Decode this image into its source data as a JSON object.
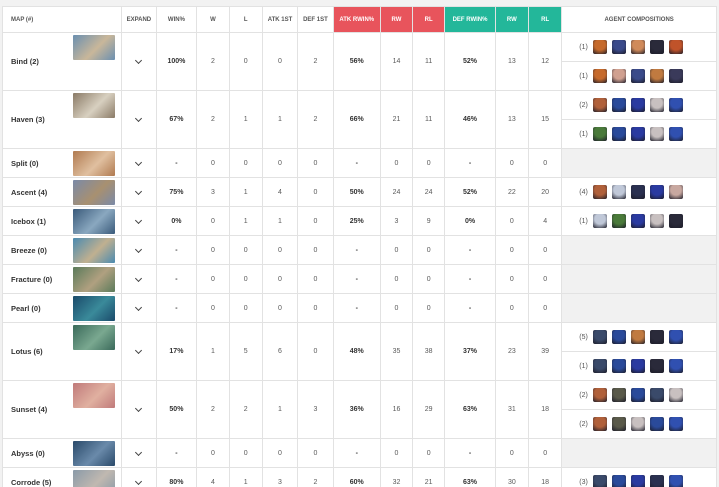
{
  "headers": {
    "map": "MAP (#)",
    "expand": "EXPAND",
    "win": "WIN%",
    "w": "W",
    "l": "L",
    "atk1st": "ATK 1ST",
    "def1st": "DEF 1ST",
    "atk_rwin": "ATK RWIN%",
    "atk_rw": "RW",
    "atk_rl": "RL",
    "def_rwin": "DEF RWIN%",
    "def_rw": "RW",
    "def_rl": "RL",
    "agents": "AGENT COMPOSITIONS"
  },
  "colors": {
    "atk": "#e8545c",
    "def": "#23b79a"
  },
  "rows": [
    {
      "map": "Bind (2)",
      "thumb": [
        "#6a8fb0",
        "#c9b79a"
      ],
      "win": "100%",
      "w": "2",
      "l": "0",
      "atk1st": "0",
      "def1st": "2",
      "atk_rwin": "56%",
      "atk_rw": "14",
      "atk_rl": "11",
      "def_rwin": "52%",
      "def_rw": "13",
      "def_rl": "12",
      "comps": [
        {
          "count": "(1)",
          "agents": [
            "#c66a2c",
            "#3a4a8a",
            "#d08a5a",
            "#2a2a3a",
            "#c0532a"
          ]
        },
        {
          "count": "(1)",
          "agents": [
            "#c66a2c",
            "#d0a090",
            "#3a4a8a",
            "#c07a40",
            "#3a3a5a"
          ]
        }
      ]
    },
    {
      "map": "Haven (3)",
      "thumb": [
        "#8a7a66",
        "#d8d0c0"
      ],
      "win": "67%",
      "w": "2",
      "l": "1",
      "atk1st": "1",
      "def1st": "2",
      "atk_rwin": "66%",
      "atk_rw": "21",
      "atk_rl": "11",
      "def_rwin": "46%",
      "def_rw": "13",
      "def_rl": "15",
      "comps": [
        {
          "count": "(2)",
          "agents": [
            "#b0603a",
            "#2a4a9a",
            "#2a3aa0",
            "#c8c0c0",
            "#3050b0"
          ]
        },
        {
          "count": "(1)",
          "agents": [
            "#4a7a3a",
            "#2a4a9a",
            "#2a3aa0",
            "#c8c0c0",
            "#3050b0"
          ]
        }
      ]
    },
    {
      "map": "Split (0)",
      "thumb": [
        "#b07a50",
        "#e0c0a0"
      ],
      "win": "-",
      "w": "0",
      "l": "0",
      "atk1st": "0",
      "def1st": "0",
      "atk_rwin": "-",
      "atk_rw": "0",
      "atk_rl": "0",
      "def_rwin": "-",
      "def_rw": "0",
      "def_rl": "0",
      "comps": []
    },
    {
      "map": "Ascent (4)",
      "thumb": [
        "#7a8aa8",
        "#a89070"
      ],
      "win": "75%",
      "w": "3",
      "l": "1",
      "atk1st": "4",
      "def1st": "0",
      "atk_rwin": "50%",
      "atk_rw": "24",
      "atk_rl": "24",
      "def_rwin": "52%",
      "def_rw": "22",
      "def_rl": "20",
      "comps": [
        {
          "count": "(4)",
          "agents": [
            "#b0603a",
            "#c0c8d8",
            "#2a3050",
            "#2a3aa0",
            "#c8a8a0"
          ]
        }
      ]
    },
    {
      "map": "Icebox (1)",
      "thumb": [
        "#3a5a7a",
        "#8aa8c0"
      ],
      "win": "0%",
      "w": "0",
      "l": "1",
      "atk1st": "1",
      "def1st": "0",
      "atk_rwin": "25%",
      "atk_rw": "3",
      "atk_rl": "9",
      "def_rwin": "0%",
      "def_rw": "0",
      "def_rl": "4",
      "comps": [
        {
          "count": "(1)",
          "agents": [
            "#c0c8d8",
            "#4a7a3a",
            "#2a3aa0",
            "#c8c0c0",
            "#2a2a3a"
          ]
        }
      ]
    },
    {
      "map": "Breeze (0)",
      "thumb": [
        "#4a8ab0",
        "#c0b090"
      ],
      "win": "-",
      "w": "0",
      "l": "0",
      "atk1st": "0",
      "def1st": "0",
      "atk_rwin": "-",
      "atk_rw": "0",
      "atk_rl": "0",
      "def_rwin": "-",
      "def_rw": "0",
      "def_rl": "0",
      "comps": []
    },
    {
      "map": "Fracture (0)",
      "thumb": [
        "#5a7a5a",
        "#b0a080"
      ],
      "win": "-",
      "w": "0",
      "l": "0",
      "atk1st": "0",
      "def1st": "0",
      "atk_rwin": "-",
      "atk_rw": "0",
      "atk_rl": "0",
      "def_rwin": "-",
      "def_rw": "0",
      "def_rl": "0",
      "comps": []
    },
    {
      "map": "Pearl (0)",
      "thumb": [
        "#1a4a6a",
        "#3a8a9a"
      ],
      "win": "-",
      "w": "0",
      "l": "0",
      "atk1st": "0",
      "def1st": "0",
      "atk_rwin": "-",
      "atk_rw": "0",
      "atk_rl": "0",
      "def_rwin": "-",
      "def_rw": "0",
      "def_rl": "0",
      "comps": []
    },
    {
      "map": "Lotus (6)",
      "thumb": [
        "#3a6a5a",
        "#7aa890"
      ],
      "win": "17%",
      "w": "1",
      "l": "5",
      "atk1st": "6",
      "def1st": "0",
      "atk_rwin": "48%",
      "atk_rw": "35",
      "atk_rl": "38",
      "def_rwin": "37%",
      "def_rw": "23",
      "def_rl": "39",
      "comps": [
        {
          "count": "(5)",
          "agents": [
            "#3a4a6a",
            "#2a4a9a",
            "#c07a40",
            "#2a2a3a",
            "#3050b0"
          ]
        },
        {
          "count": "(1)",
          "agents": [
            "#3a4a6a",
            "#2a4a9a",
            "#2a3aa0",
            "#2a2a3a",
            "#3050b0"
          ]
        }
      ]
    },
    {
      "map": "Sunset (4)",
      "thumb": [
        "#c07a7a",
        "#e0b0a0"
      ],
      "win": "50%",
      "w": "2",
      "l": "2",
      "atk1st": "1",
      "def1st": "3",
      "atk_rwin": "36%",
      "atk_rw": "16",
      "atk_rl": "29",
      "def_rwin": "63%",
      "def_rw": "31",
      "def_rl": "18",
      "comps": [
        {
          "count": "(2)",
          "agents": [
            "#b0603a",
            "#5a5a4a",
            "#2a4a9a",
            "#3a4a6a",
            "#c8c0c0"
          ]
        },
        {
          "count": "(2)",
          "agents": [
            "#b0603a",
            "#5a5a4a",
            "#c8c0c0",
            "#2a4a9a",
            "#3050b0"
          ]
        }
      ]
    },
    {
      "map": "Abyss (0)",
      "thumb": [
        "#2a4a6a",
        "#6a8aaa"
      ],
      "win": "-",
      "w": "0",
      "l": "0",
      "atk1st": "0",
      "def1st": "0",
      "atk_rwin": "-",
      "atk_rw": "0",
      "atk_rl": "0",
      "def_rwin": "-",
      "def_rw": "0",
      "def_rl": "0",
      "comps": []
    },
    {
      "map": "Corrode (5)",
      "thumb": [
        "#8a9aa8",
        "#c0b8b0"
      ],
      "win": "80%",
      "w": "4",
      "l": "1",
      "atk1st": "3",
      "def1st": "2",
      "atk_rwin": "60%",
      "atk_rw": "32",
      "atk_rl": "21",
      "def_rwin": "63%",
      "def_rw": "30",
      "def_rl": "18",
      "comps": [
        {
          "count": "(3)",
          "agents": [
            "#3a4a6a",
            "#2a4a9a",
            "#2a3aa0",
            "#2a3050",
            "#3050b0"
          ]
        }
      ]
    }
  ]
}
